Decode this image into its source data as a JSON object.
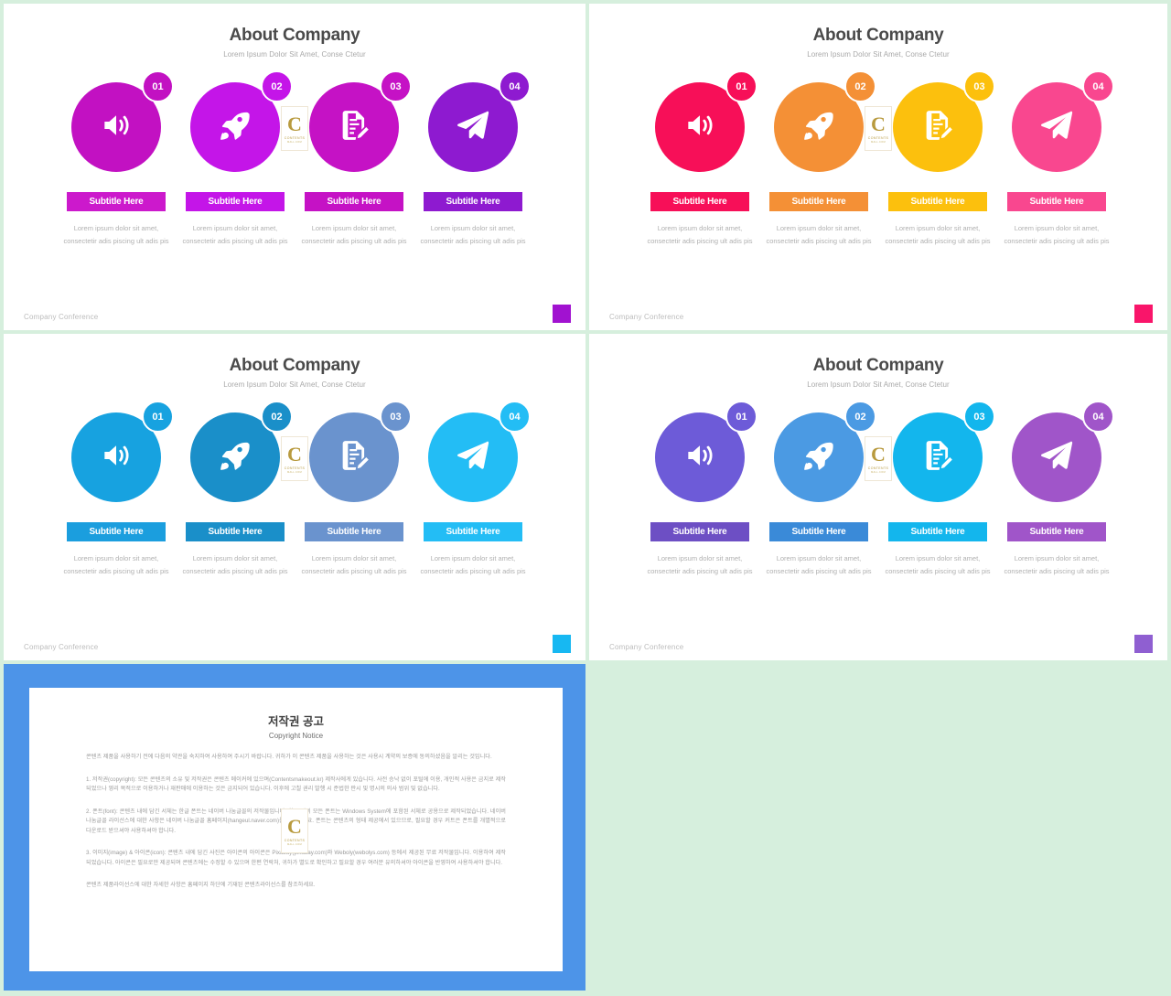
{
  "page": {
    "background_color": "#d6efdd"
  },
  "slides": [
    {
      "id": "slide-magenta",
      "title": "About Company",
      "subtitle": "Lorem Ipsum Dolor Sit Amet, Conse Ctetur",
      "footer": "Company Conference",
      "accent_square_color": "#a112d0",
      "columns": [
        {
          "number": "01",
          "icon": "speaker-icon",
          "label": "Subtitle Here",
          "body": "Lorem ipsum dolor sit amet, consectetir adis piscing ult adis pis",
          "circle_color": "#c211c2",
          "badge_color": "#c211c2",
          "button_color": "#cc19cc"
        },
        {
          "number": "02",
          "icon": "rocket-icon",
          "label": "Subtitle Here",
          "body": "Lorem ipsum dolor sit amet, consectetir adis piscing ult adis pis",
          "circle_color": "#c415e8",
          "badge_color": "#c415e8",
          "button_color": "#c415e8"
        },
        {
          "number": "03",
          "icon": "document-edit-icon",
          "label": "Subtitle Here",
          "body": "Lorem ipsum dolor sit amet, consectetir adis piscing ult adis pis",
          "circle_color": "#c512c5",
          "badge_color": "#c512c5",
          "button_color": "#c512c5"
        },
        {
          "number": "04",
          "icon": "paper-plane-icon",
          "label": "Subtitle Here",
          "body": "Lorem ipsum dolor sit amet, consectetir adis piscing ult adis pis",
          "circle_color": "#8e1ad0",
          "badge_color": "#8e1ad0",
          "button_color": "#8e1ad0"
        }
      ]
    },
    {
      "id": "slide-warm",
      "title": "About Company",
      "subtitle": "Lorem Ipsum Dolor Sit Amet, Conse Ctetur",
      "footer": "Company Conference",
      "accent_square_color": "#f9156a",
      "columns": [
        {
          "number": "01",
          "icon": "speaker-icon",
          "label": "Subtitle Here",
          "body": "Lorem ipsum dolor sit amet, consectetir adis piscing ult adis pis",
          "circle_color": "#f70f58",
          "badge_color": "#f70f58",
          "button_color": "#f70f58"
        },
        {
          "number": "02",
          "icon": "rocket-icon",
          "label": "Subtitle Here",
          "body": "Lorem ipsum dolor sit amet, consectetir adis piscing ult adis pis",
          "circle_color": "#f49036",
          "badge_color": "#f49036",
          "button_color": "#f49036"
        },
        {
          "number": "03",
          "icon": "document-edit-icon",
          "label": "Subtitle Here",
          "body": "Lorem ipsum dolor sit amet, consectetir adis piscing ult adis pis",
          "circle_color": "#fcc00d",
          "badge_color": "#fcc00d",
          "button_color": "#fcc00d"
        },
        {
          "number": "04",
          "icon": "paper-plane-icon",
          "label": "Subtitle Here",
          "body": "Lorem ipsum dolor sit amet, consectetir adis piscing ult adis pis",
          "circle_color": "#f9478f",
          "badge_color": "#f9478f",
          "button_color": "#f9478f"
        }
      ]
    },
    {
      "id": "slide-blue",
      "title": "About Company",
      "subtitle": "Lorem Ipsum Dolor Sit Amet, Conse Ctetur",
      "footer": "Company Conference",
      "accent_square_color": "#17b8f2",
      "columns": [
        {
          "number": "01",
          "icon": "speaker-icon",
          "label": "Subtitle Here",
          "body": "Lorem ipsum dolor sit amet, consectetir adis piscing ult adis pis",
          "circle_color": "#17a2e0",
          "badge_color": "#17a2e0",
          "button_color": "#1b9ede"
        },
        {
          "number": "02",
          "icon": "rocket-icon",
          "label": "Subtitle Here",
          "body": "Lorem ipsum dolor sit amet, consectetir adis piscing ult adis pis",
          "circle_color": "#1a8fc9",
          "badge_color": "#1a8fc9",
          "button_color": "#1a8fc9"
        },
        {
          "number": "03",
          "icon": "document-edit-icon",
          "label": "Subtitle Here",
          "body": "Lorem ipsum dolor sit amet, consectetir adis piscing ult adis pis",
          "circle_color": "#6a93ce",
          "badge_color": "#6a93ce",
          "button_color": "#6a93ce"
        },
        {
          "number": "04",
          "icon": "paper-plane-icon",
          "label": "Subtitle Here",
          "body": "Lorem ipsum dolor sit amet, consectetir adis piscing ult adis pis",
          "circle_color": "#23bdf5",
          "badge_color": "#23bdf5",
          "button_color": "#23bdf5"
        }
      ]
    },
    {
      "id": "slide-violet",
      "title": "About Company",
      "subtitle": "Lorem Ipsum Dolor Sit Amet, Conse Ctetur",
      "footer": "Company Conference",
      "accent_square_color": "#8f5fd1",
      "columns": [
        {
          "number": "01",
          "icon": "speaker-icon",
          "label": "Subtitle Here",
          "body": "Lorem ipsum dolor sit amet, consectetir adis piscing ult adis pis",
          "circle_color": "#6d5bd8",
          "badge_color": "#6d5bd8",
          "button_color": "#6d4fc4"
        },
        {
          "number": "02",
          "icon": "rocket-icon",
          "label": "Subtitle Here",
          "body": "Lorem ipsum dolor sit amet, consectetir adis piscing ult adis pis",
          "circle_color": "#4b9ae3",
          "badge_color": "#4b9ae3",
          "button_color": "#3a8ad8"
        },
        {
          "number": "03",
          "icon": "document-edit-icon",
          "label": "Subtitle Here",
          "body": "Lorem ipsum dolor sit amet, consectetir adis piscing ult adis pis",
          "circle_color": "#13b6ed",
          "badge_color": "#13b6ed",
          "button_color": "#13b6ed"
        },
        {
          "number": "04",
          "icon": "paper-plane-icon",
          "label": "Subtitle Here",
          "body": "Lorem ipsum dolor sit amet, consectetir adis piscing ult adis pis",
          "circle_color": "#a055c9",
          "badge_color": "#a055c9",
          "button_color": "#a055c9"
        }
      ]
    }
  ],
  "watermark": {
    "letter": "C",
    "line1": "CONTENTS",
    "line2": "MALL.COM"
  },
  "copyright_slide": {
    "frame_color": "#4d94e8",
    "title": "저작권 공고",
    "subtitle": "Copyright Notice",
    "paragraphs": [
      "콘텐츠 제품을 사용하기 전에 다음의 약관을 숙지하여 사용하여 주시기 바랍니다. 귀하가 이 콘텐츠 제품을 사용하는 것은 사용시 계약의 보증에 동의하셨음을 알리는 것입니다.",
      "1. 저작권(copyright): 모든 콘텐츠의 소유 및 저작권은 콘텐츠 메이커에 있으며(Contentsmakeout.kr) 제작사에게 있습니다. 사전 승낙 없이 포털에 이용, 개인적 사용은 금지로 제작되었으나 영리 목적으로 이용하거나 재판매에 이용하는 것은 금지되어 있습니다. 이후에 고칠 권리 발행 시 준법한 판시 및 명시의 의사 범위 및 없습니다.",
      "2. 폰트(font): 콘텐츠 내에 담긴 서체는 한글 폰트는 네이버 나눔글꼴의 저작물입니다. 한글 외의 모든 폰트는 Windows System에 포함된 서체로 공용으로 제작되었습니다. 네이버 나눔글꼴 라이선스에 대한 사항은 네이버 나눔글꼴 홈페이지(hangeul.naver.com)를 참조하세요. 폰트는 콘텐츠의 형태 제공에서 있으므로, 필요할 경우 커트은 폰트를 개별적으로 다운로드 받으셔야 사용하셔야 합니다.",
      "3. 이미지(image) & 아이콘(icon): 콘텐츠 내에 담긴 사진은 아이콘의 아이콘은 Pixabay(pixabay.com)와 Weboly(webolys.com) 등에서 제공된 무료 저작물입니다. 이용하여 제작되었습니다. 아이콘은 필요로만 제공되며 콘텐츠에는 수정할 수 있으며 한편 연락처, 귀하가 별도로 확인하고 필요할 경우 여러분 유의하셔야 아이콘을 반영하여 사용하셔야 합니다.",
      "콘텐츠 제품라이선스에 대한 자세한 사항은 홈페이지 하단에 기재된 콘텐츠라이선스를 참조하세요."
    ]
  }
}
